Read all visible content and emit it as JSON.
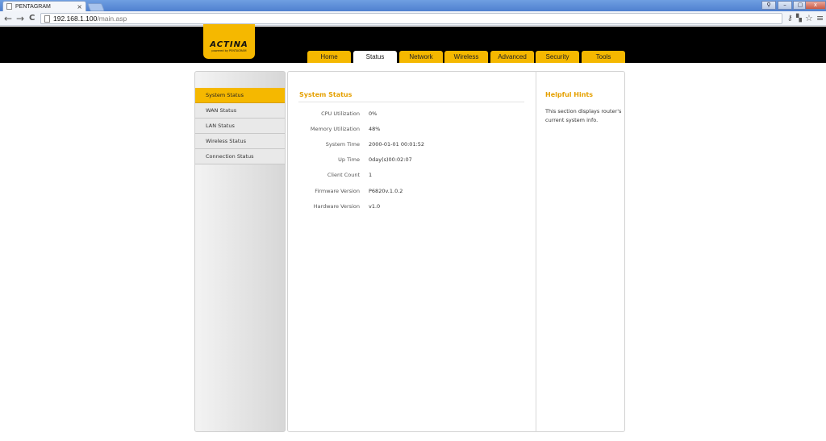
{
  "browser": {
    "tab_title": "PENTAGRAM",
    "tab_close": "×",
    "address_host": "192.168.1.100",
    "address_path": "/main.asp",
    "back": "←",
    "forward": "→",
    "reload": "C",
    "star": "☆",
    "menu": "≡",
    "win_min": "–",
    "win_max": "▢",
    "win_close": "x",
    "win_user": "⚲"
  },
  "logo": {
    "main": "ACTINA",
    "sub": "powered by PENTAGRAM"
  },
  "nav": {
    "tabs": [
      {
        "label": "Home"
      },
      {
        "label": "Status"
      },
      {
        "label": "Network"
      },
      {
        "label": "Wireless"
      },
      {
        "label": "Advanced"
      },
      {
        "label": "Security"
      },
      {
        "label": "Tools"
      }
    ],
    "active": "Status"
  },
  "sidebar": {
    "items": [
      {
        "label": "System Status"
      },
      {
        "label": "WAN Status"
      },
      {
        "label": "LAN Status"
      },
      {
        "label": "Wireless Status"
      },
      {
        "label": "Connection Status"
      }
    ]
  },
  "main": {
    "title": "System Status",
    "rows": [
      {
        "label": "CPU Utilization",
        "value": "0%"
      },
      {
        "label": "Memory Utilization",
        "value": "48%"
      },
      {
        "label": "System Time",
        "value": "2000-01-01 00:01:52"
      },
      {
        "label": "Up Time",
        "value": "0day(s)00:02:07"
      },
      {
        "label": "Client Count",
        "value": "1"
      },
      {
        "label": "Firmware Version",
        "value": "P6820v.1.0.2"
      },
      {
        "label": "Hardware Version",
        "value": "v1.0"
      }
    ]
  },
  "hints": {
    "title": "Helpful Hints",
    "text": "This section displays router's current system info."
  },
  "colors": {
    "accent": "#f5b800",
    "title_orange": "#e5a000",
    "header_bg": "#000000"
  }
}
